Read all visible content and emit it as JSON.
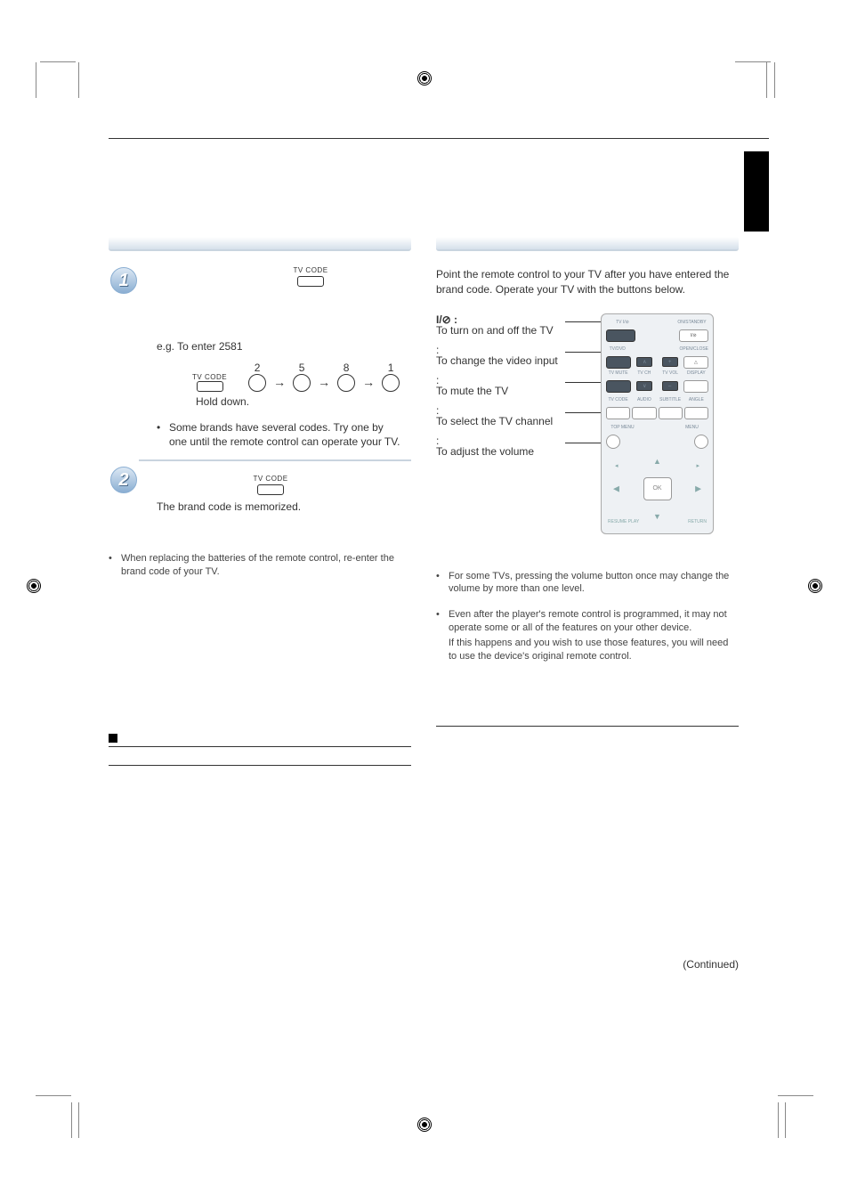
{
  "page": {
    "continued": "(Continued)"
  },
  "left": {
    "step1": {
      "label": "TV CODE",
      "eg": "e.g. To enter 2581",
      "digits": [
        "2",
        "5",
        "8",
        "1"
      ],
      "hold": "Hold down.",
      "note": "Some brands have several codes. Try one by one until the remote control can operate your TV."
    },
    "step2": {
      "label": "TV CODE",
      "memorized": "The brand code is memorized."
    },
    "battery_note": "When replacing the batteries of the remote control, re-enter the brand code of your TV."
  },
  "right": {
    "intro": "Point the remote control to your TV after you have entered the brand code. Operate your TV with the buttons below.",
    "funcs": {
      "power_sym": "I/⊘ :",
      "power": "To turn on and off the TV",
      "input_lbl": ":",
      "input": "To change the video input",
      "mute_lbl": ":",
      "mute": "To mute the TV",
      "ch_lbl": ":",
      "ch": "To select the TV channel",
      "vol_lbl": ":",
      "vol": "To adjust the volume"
    },
    "remote": {
      "tv_power": "TV I/⊘",
      "onstandby": "ON/STANDBY",
      "power2": "I/⊘",
      "tvdvd": "TV/DVD",
      "openclose": "OPEN/CLOSE",
      "eject": "△",
      "tvmute": "TV MUTE",
      "tvch": "TV CH",
      "tvvol": "TV VOL",
      "display": "DISPLAY",
      "tvcode": "TV CODE",
      "audio": "AUDIO",
      "subtitle": "SUBTITLE",
      "angle": "ANGLE",
      "topmenu": "TOP MENU",
      "menu": "MENU",
      "ok": "OK",
      "resume": "RESUME PLAY",
      "return": "RETURN",
      "plus": "+",
      "minus": "–",
      "up": "∧",
      "down": "∨"
    },
    "notes": {
      "n1": "For some TVs, pressing the volume button once may change the volume by more than one level.",
      "n2": "Even after the player's remote control is programmed, it may not operate some or all of the features on your other device.",
      "n2b": "If this happens and you wish to use those features, you will need to use the device's original remote control."
    }
  }
}
